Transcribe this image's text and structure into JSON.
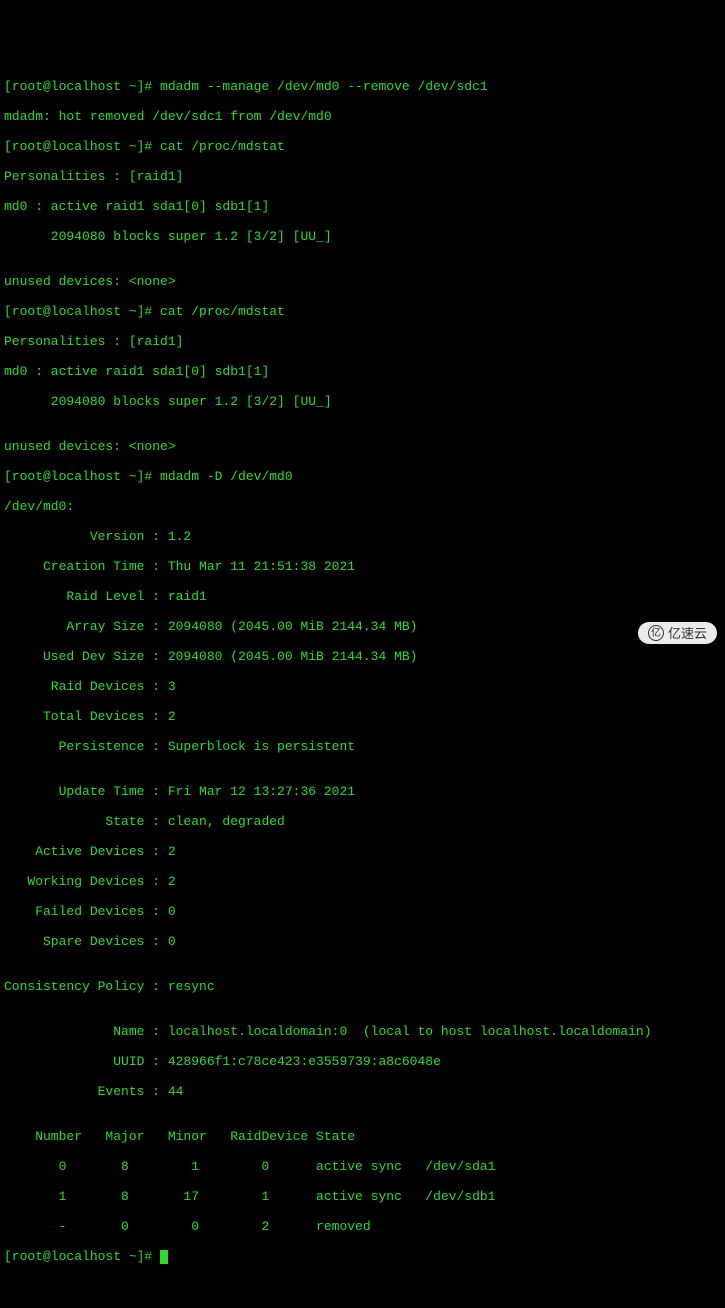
{
  "lines": [
    "[root@localhost ~]# mdadm --manage /dev/md0 --remove /dev/sdc1",
    "mdadm: hot removed /dev/sdc1 from /dev/md0",
    "[root@localhost ~]# cat /proc/mdstat",
    "Personalities : [raid1]",
    "md0 : active raid1 sda1[0] sdb1[1]",
    "      2094080 blocks super 1.2 [3/2] [UU_]",
    "",
    "unused devices: <none>",
    "[root@localhost ~]# cat /proc/mdstat",
    "Personalities : [raid1]",
    "md0 : active raid1 sda1[0] sdb1[1]",
    "      2094080 blocks super 1.2 [3/2] [UU_]",
    "",
    "unused devices: <none>",
    "[root@localhost ~]# mdadm -D /dev/md0",
    "/dev/md0:",
    "           Version : 1.2",
    "     Creation Time : Thu Mar 11 21:51:38 2021",
    "        Raid Level : raid1",
    "        Array Size : 2094080 (2045.00 MiB 2144.34 MB)",
    "     Used Dev Size : 2094080 (2045.00 MiB 2144.34 MB)",
    "      Raid Devices : 3",
    "     Total Devices : 2",
    "       Persistence : Superblock is persistent",
    "",
    "       Update Time : Fri Mar 12 13:27:36 2021",
    "             State : clean, degraded",
    "    Active Devices : 2",
    "   Working Devices : 2",
    "    Failed Devices : 0",
    "     Spare Devices : 0",
    "",
    "Consistency Policy : resync",
    "",
    "              Name : localhost.localdomain:0  (local to host localhost.localdomain)",
    "              UUID : 428966f1:c78ce423:e3559739:a8c6048e",
    "            Events : 44",
    "",
    "    Number   Major   Minor   RaidDevice State",
    "       0       8        1        0      active sync   /dev/sda1",
    "       1       8       17        1      active sync   /dev/sdb1",
    "       -       0        0        2      removed"
  ],
  "prompt_final": "[root@localhost ~]# ",
  "watermark": "亿速云"
}
